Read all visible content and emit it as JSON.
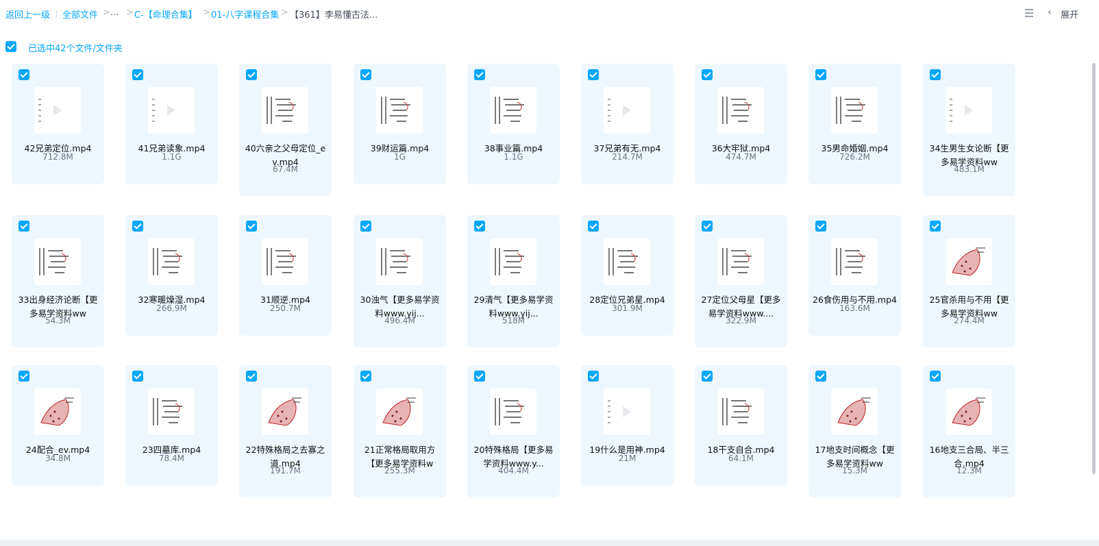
{
  "breadcrumb": {
    "back": "返回上一级",
    "all_files": "全部文件",
    "ellipsis": "...",
    "level1": "C-【命理合集】",
    "level2": "01-八字课程合集",
    "current": "【361】李易懂古法..."
  },
  "toolbar": {
    "expand_label": "展开"
  },
  "selection": {
    "label": "已选中42个文件/文件夹"
  },
  "files": [
    {
      "name": "42兄弟定位.mp4",
      "size": "712.8M",
      "thumb": "light"
    },
    {
      "name": "41兄弟读象.mp4",
      "size": "1.1G",
      "thumb": "light"
    },
    {
      "name": "40六亲之父母定位_ev.mp4",
      "size": "67.4M",
      "thumb": "dark"
    },
    {
      "name": "39财运篇.mp4",
      "size": "1G",
      "thumb": "dark"
    },
    {
      "name": "38事业篇.mp4",
      "size": "1.1G",
      "thumb": "dark"
    },
    {
      "name": "37兄弟有无.mp4",
      "size": "214.7M",
      "thumb": "light"
    },
    {
      "name": "36大牢狱.mp4",
      "size": "474.7M",
      "thumb": "dark"
    },
    {
      "name": "35男命婚姻.mp4",
      "size": "726.2M",
      "thumb": "dark"
    },
    {
      "name": "34生男生女论断【更多易学资料ww",
      "size": "483.1M",
      "thumb": "light"
    },
    {
      "name": "33出身经济论断【更多易学资料ww",
      "size": "54.3M",
      "thumb": "dark"
    },
    {
      "name": "32寒暖燥湿.mp4",
      "size": "266.9M",
      "thumb": "dark"
    },
    {
      "name": "31顺逆.mp4",
      "size": "250.7M",
      "thumb": "dark"
    },
    {
      "name": "30浊气【更多易学资料www.yij...",
      "size": "496.4M",
      "thumb": "dark"
    },
    {
      "name": "29清气【更多易学资料www.yij...",
      "size": "518M",
      "thumb": "dark"
    },
    {
      "name": "28定位兄弟星.mp4",
      "size": "301.9M",
      "thumb": "dark"
    },
    {
      "name": "27定位父母星【更多易学资料www....",
      "size": "322.9M",
      "thumb": "dark"
    },
    {
      "name": "26食伤用与不用.mp4",
      "size": "163.6M",
      "thumb": "dark"
    },
    {
      "name": "25官杀用与不用【更多易学资料ww",
      "size": "274.4M",
      "thumb": "red"
    },
    {
      "name": "24配合_ev.mp4",
      "size": "34.8M",
      "thumb": "red"
    },
    {
      "name": "23四墓库.mp4",
      "size": "78.4M",
      "thumb": "dark"
    },
    {
      "name": "22特殊格局之去寡之道.mp4",
      "size": "191.7M",
      "thumb": "red"
    },
    {
      "name": "21正常格局取用方【更多易学资料w",
      "size": "255.3M",
      "thumb": "red"
    },
    {
      "name": "20特殊格局【更多易学资料www.y...",
      "size": "404.4M",
      "thumb": "dark"
    },
    {
      "name": "19什么是用神.mp4",
      "size": "21M",
      "thumb": "light"
    },
    {
      "name": "18干支自合.mp4",
      "size": "64.1M",
      "thumb": "dark"
    },
    {
      "name": "17地支时间概念【更多易学资料ww",
      "size": "15.3M",
      "thumb": "red"
    },
    {
      "name": "16地支三合局、半三合.mp4",
      "size": "12.3M",
      "thumb": "red"
    }
  ]
}
